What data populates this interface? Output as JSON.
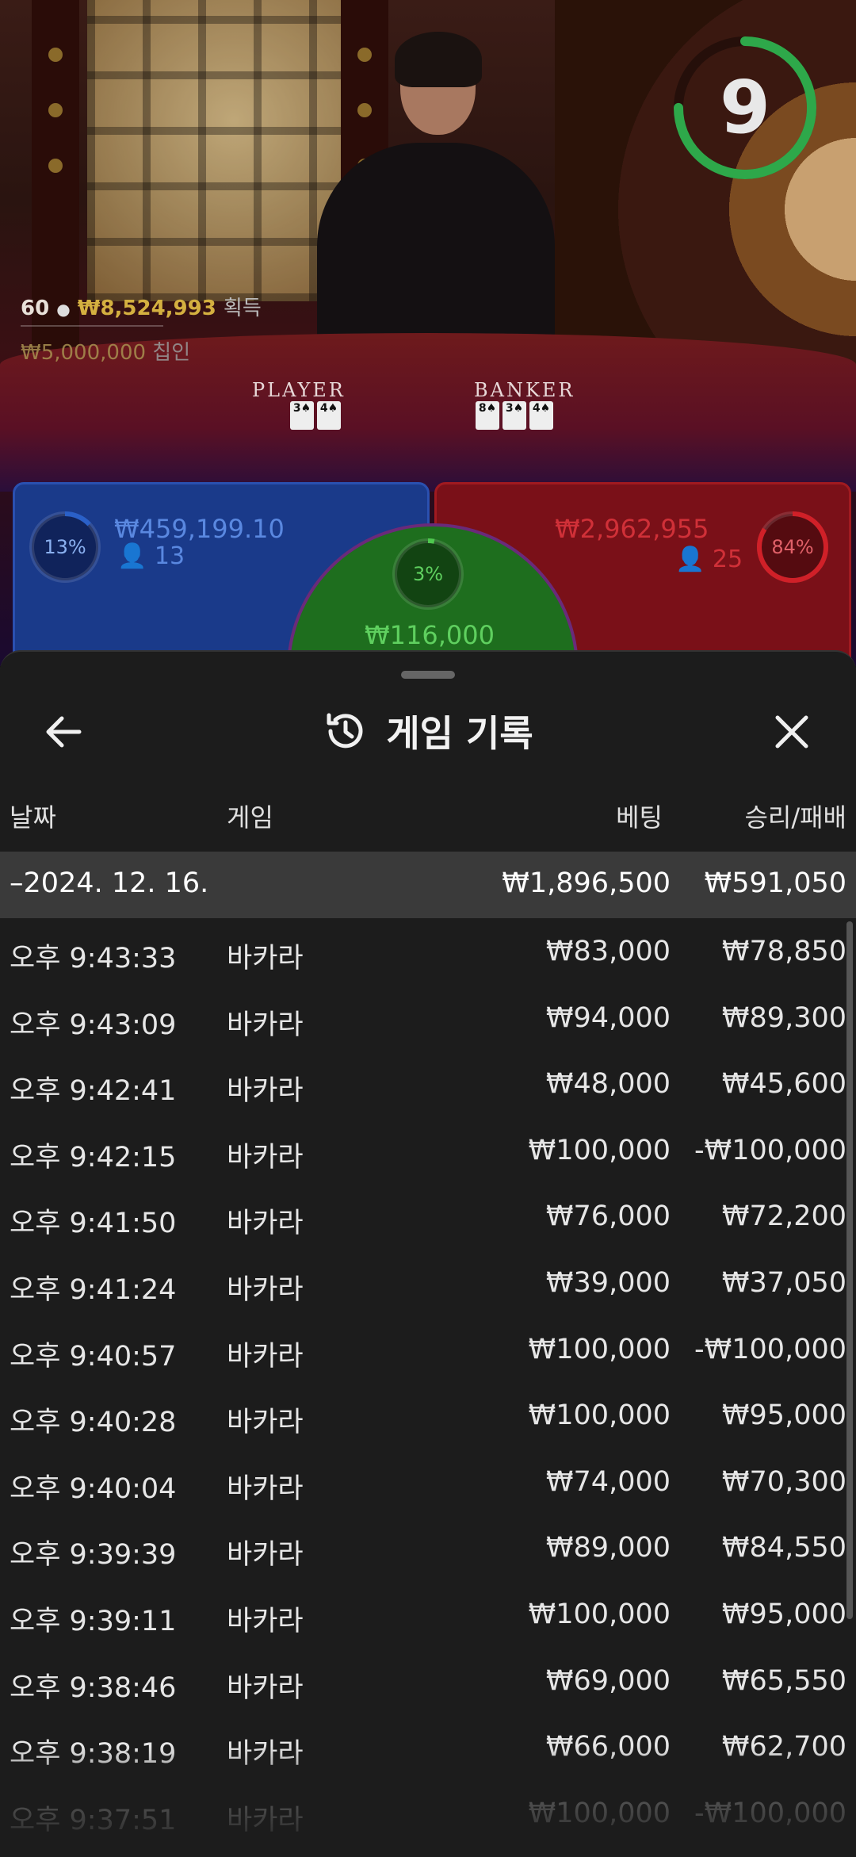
{
  "timer": {
    "value": "9",
    "fraction": 0.75
  },
  "stats": {
    "count": "60",
    "won": "₩8,524,993",
    "won_label": "획득",
    "wagered": "₩5,000,000",
    "wagered_label": "칩인"
  },
  "table": {
    "player_label": "PLAYER",
    "banker_label": "BANKER"
  },
  "bets": {
    "player": {
      "percent": "13%",
      "amount": "₩459,199.10",
      "players": "13",
      "fraction": 0.13
    },
    "tie": {
      "percent": "3%",
      "amount": "₩116,000",
      "fraction": 0.03
    },
    "banker": {
      "percent": "84%",
      "amount": "₩2,962,955",
      "players": "25",
      "fraction": 0.84
    }
  },
  "colors": {
    "player": "#2a60c8",
    "banker": "#d02028",
    "tie": "#4ec84e",
    "sheet_bg": "#1c1c1c",
    "summary_bg": "#3a3a3a"
  },
  "history": {
    "title": "게임 기록",
    "icons": {
      "back": "arrow-left-icon",
      "history": "history-clock-icon",
      "close": "close-icon"
    },
    "columns": {
      "date": "날짜",
      "game": "게임",
      "bet": "베팅",
      "result": "승리/패배"
    },
    "summary": {
      "date": "–2024. 12. 16.",
      "bet": "₩1,896,500",
      "result": "₩591,050"
    },
    "rows": [
      {
        "time": "오후 9:43:33",
        "game": "바카라",
        "bet": "₩83,000",
        "result": "₩78,850"
      },
      {
        "time": "오후 9:43:09",
        "game": "바카라",
        "bet": "₩94,000",
        "result": "₩89,300"
      },
      {
        "time": "오후 9:42:41",
        "game": "바카라",
        "bet": "₩48,000",
        "result": "₩45,600"
      },
      {
        "time": "오후 9:42:15",
        "game": "바카라",
        "bet": "₩100,000",
        "result": "-₩100,000"
      },
      {
        "time": "오후 9:41:50",
        "game": "바카라",
        "bet": "₩76,000",
        "result": "₩72,200"
      },
      {
        "time": "오후 9:41:24",
        "game": "바카라",
        "bet": "₩39,000",
        "result": "₩37,050"
      },
      {
        "time": "오후 9:40:57",
        "game": "바카라",
        "bet": "₩100,000",
        "result": "-₩100,000"
      },
      {
        "time": "오후 9:40:28",
        "game": "바카라",
        "bet": "₩100,000",
        "result": "₩95,000"
      },
      {
        "time": "오후 9:40:04",
        "game": "바카라",
        "bet": "₩74,000",
        "result": "₩70,300"
      },
      {
        "time": "오후 9:39:39",
        "game": "바카라",
        "bet": "₩89,000",
        "result": "₩84,550"
      },
      {
        "time": "오후 9:39:11",
        "game": "바카라",
        "bet": "₩100,000",
        "result": "₩95,000"
      },
      {
        "time": "오후 9:38:46",
        "game": "바카라",
        "bet": "₩69,000",
        "result": "₩65,550"
      },
      {
        "time": "오후 9:38:19",
        "game": "바카라",
        "bet": "₩66,000",
        "result": "₩62,700"
      },
      {
        "time": "오후 9:37:51",
        "game": "바카라",
        "bet": "₩100,000",
        "result": "-₩100,000"
      }
    ]
  }
}
